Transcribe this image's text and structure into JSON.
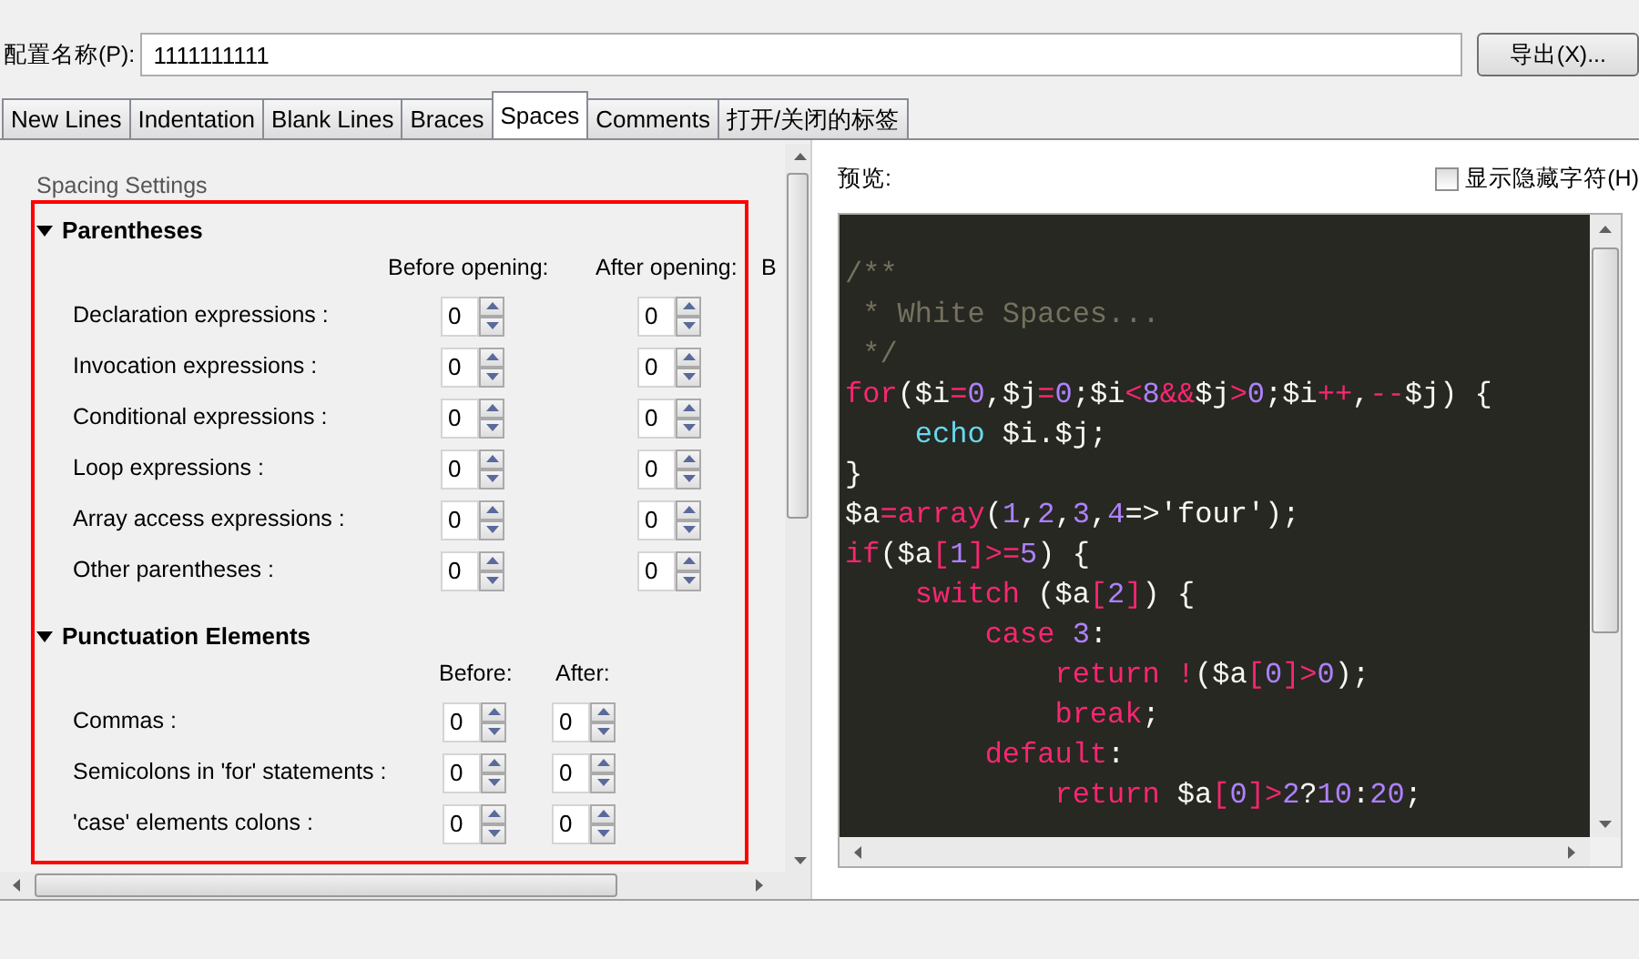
{
  "profile": {
    "label": "配置名称(P):",
    "value": "1111111111",
    "export_button": "导出(X)..."
  },
  "tabs": [
    {
      "label": "New Lines",
      "selected": false
    },
    {
      "label": "Indentation",
      "selected": false
    },
    {
      "label": "Blank Lines",
      "selected": false
    },
    {
      "label": "Braces",
      "selected": false
    },
    {
      "label": "Spaces",
      "selected": true
    },
    {
      "label": "Comments",
      "selected": false
    },
    {
      "label": "打开/关闭的标签",
      "selected": false
    }
  ],
  "settings": {
    "title": "Spacing Settings",
    "sections": [
      {
        "title": "Parentheses",
        "expanded": true,
        "columns": [
          "Before opening:",
          "After opening:",
          "B"
        ],
        "rows": [
          {
            "label": "Declaration expressions :",
            "values": [
              "0",
              "0"
            ]
          },
          {
            "label": "Invocation expressions :",
            "values": [
              "0",
              "0"
            ]
          },
          {
            "label": "Conditional expressions :",
            "values": [
              "0",
              "0"
            ]
          },
          {
            "label": "Loop expressions :",
            "values": [
              "0",
              "0"
            ]
          },
          {
            "label": "Array access expressions :",
            "values": [
              "0",
              "0"
            ]
          },
          {
            "label": "Other parentheses :",
            "values": [
              "0",
              "0"
            ]
          }
        ]
      },
      {
        "title": "Punctuation Elements",
        "expanded": true,
        "columns": [
          "Before:",
          "After:"
        ],
        "rows": [
          {
            "label": "Commas :",
            "values": [
              "0",
              "0"
            ]
          },
          {
            "label": "Semicolons in 'for' statements :",
            "values": [
              "0",
              "0"
            ]
          },
          {
            "label": "'case' elements colons :",
            "values": [
              "0",
              "0"
            ]
          }
        ]
      }
    ]
  },
  "preview": {
    "label": "预览:",
    "show_hidden": {
      "label": "显示隐藏字符(H)",
      "checked": false
    },
    "code": [
      [
        {
          "text": "/**",
          "kind": "comment"
        }
      ],
      [
        {
          "text": " * White Spaces...",
          "kind": "comment"
        }
      ],
      [
        {
          "text": " */",
          "kind": "comment"
        }
      ],
      [
        {
          "text": "for",
          "kind": "keyword"
        },
        {
          "text": "($i",
          "kind": "plain"
        },
        {
          "text": "=",
          "kind": "operator"
        },
        {
          "text": "0",
          "kind": "number"
        },
        {
          "text": ",$j",
          "kind": "plain"
        },
        {
          "text": "=",
          "kind": "operator"
        },
        {
          "text": "0",
          "kind": "number"
        },
        {
          "text": ";$i",
          "kind": "plain"
        },
        {
          "text": "<",
          "kind": "operator"
        },
        {
          "text": "8",
          "kind": "number"
        },
        {
          "text": "&&",
          "kind": "operator"
        },
        {
          "text": "$j",
          "kind": "plain"
        },
        {
          "text": ">",
          "kind": "operator"
        },
        {
          "text": "0",
          "kind": "number"
        },
        {
          "text": ";$i",
          "kind": "plain"
        },
        {
          "text": "++",
          "kind": "operator"
        },
        {
          "text": ",",
          "kind": "plain"
        },
        {
          "text": "--",
          "kind": "operator"
        },
        {
          "text": "$j) {",
          "kind": "plain"
        }
      ],
      [
        {
          "text": "    echo",
          "kind": "builtin"
        },
        {
          "text": " $i.$j;",
          "kind": "plain"
        }
      ],
      [
        {
          "text": "}",
          "kind": "plain"
        }
      ],
      [
        {
          "text": "$a",
          "kind": "plain"
        },
        {
          "text": "=",
          "kind": "operator"
        },
        {
          "text": "array",
          "kind": "keyword"
        },
        {
          "text": "(",
          "kind": "plain"
        },
        {
          "text": "1",
          "kind": "number"
        },
        {
          "text": ",",
          "kind": "plain"
        },
        {
          "text": "2",
          "kind": "number"
        },
        {
          "text": ",",
          "kind": "plain"
        },
        {
          "text": "3",
          "kind": "number"
        },
        {
          "text": ",",
          "kind": "plain"
        },
        {
          "text": "4",
          "kind": "number"
        },
        {
          "text": "=>'four');",
          "kind": "plain"
        }
      ],
      [
        {
          "text": "if",
          "kind": "keyword"
        },
        {
          "text": "($a",
          "kind": "plain"
        },
        {
          "text": "[",
          "kind": "operator"
        },
        {
          "text": "1",
          "kind": "number"
        },
        {
          "text": "]>=",
          "kind": "operator"
        },
        {
          "text": "5",
          "kind": "number"
        },
        {
          "text": ") {",
          "kind": "plain"
        }
      ],
      [
        {
          "text": "    switch",
          "kind": "keyword"
        },
        {
          "text": " ($a",
          "kind": "plain"
        },
        {
          "text": "[",
          "kind": "operator"
        },
        {
          "text": "2",
          "kind": "number"
        },
        {
          "text": "]",
          "kind": "operator"
        },
        {
          "text": ") {",
          "kind": "plain"
        }
      ],
      [
        {
          "text": "        case",
          "kind": "keyword"
        },
        {
          "text": " 3",
          "kind": "number"
        },
        {
          "text": ":",
          "kind": "plain"
        }
      ],
      [
        {
          "text": "            return",
          "kind": "keyword"
        },
        {
          "text": " !",
          "kind": "operator"
        },
        {
          "text": "($a",
          "kind": "plain"
        },
        {
          "text": "[",
          "kind": "operator"
        },
        {
          "text": "0",
          "kind": "number"
        },
        {
          "text": "]>",
          "kind": "operator"
        },
        {
          "text": "0",
          "kind": "number"
        },
        {
          "text": ");",
          "kind": "plain"
        }
      ],
      [
        {
          "text": "            break",
          "kind": "keyword"
        },
        {
          "text": ";",
          "kind": "plain"
        }
      ],
      [
        {
          "text": "        default",
          "kind": "keyword"
        },
        {
          "text": ":",
          "kind": "plain"
        }
      ],
      [
        {
          "text": "            return",
          "kind": "keyword"
        },
        {
          "text": " $a",
          "kind": "plain"
        },
        {
          "text": "[",
          "kind": "operator"
        },
        {
          "text": "0",
          "kind": "number"
        },
        {
          "text": "]>",
          "kind": "operator"
        },
        {
          "text": "2",
          "kind": "number"
        },
        {
          "text": "?",
          "kind": "plain"
        },
        {
          "text": "10",
          "kind": "number"
        },
        {
          "text": ":",
          "kind": "plain"
        },
        {
          "text": "20",
          "kind": "number"
        },
        {
          "text": ";",
          "kind": "plain"
        }
      ]
    ]
  }
}
